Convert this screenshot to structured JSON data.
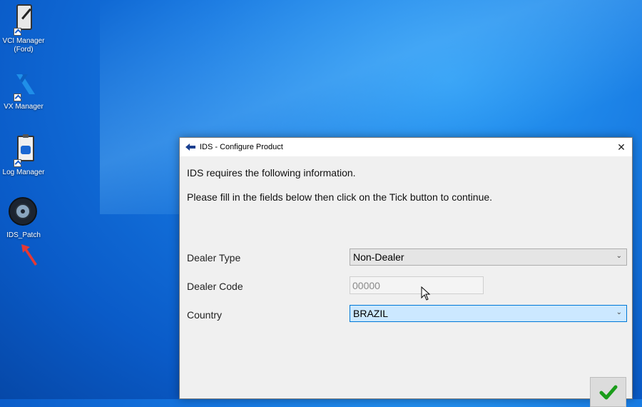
{
  "desktop": {
    "icons": [
      {
        "label_line1": "VCI Manager",
        "label_line2": "(Ford)"
      },
      {
        "label_line1": "VX Manager",
        "label_line2": ""
      },
      {
        "label_line1": "Log Manager",
        "label_line2": ""
      },
      {
        "label_line1": "IDS_Patch",
        "label_line2": ""
      }
    ]
  },
  "dialog": {
    "title": "IDS - Configure Product",
    "close_glyph": "✕",
    "message_line1": "IDS requires the following information.",
    "message_line2": "Please fill in the fields below then click on the Tick button to continue.",
    "fields": {
      "dealer_type": {
        "label": "Dealer Type",
        "value": "Non-Dealer"
      },
      "dealer_code": {
        "label": "Dealer Code",
        "value": "00000"
      },
      "country": {
        "label": "Country",
        "value": "BRAZIL"
      }
    },
    "ok_icon": "checkmark-icon"
  },
  "colors": {
    "desktop_blue": "#1576e0",
    "focus_blue": "#0078d7",
    "focus_fill": "#cce8ff",
    "tick_green": "#1a9c1a",
    "annotation_red": "#e53935"
  }
}
